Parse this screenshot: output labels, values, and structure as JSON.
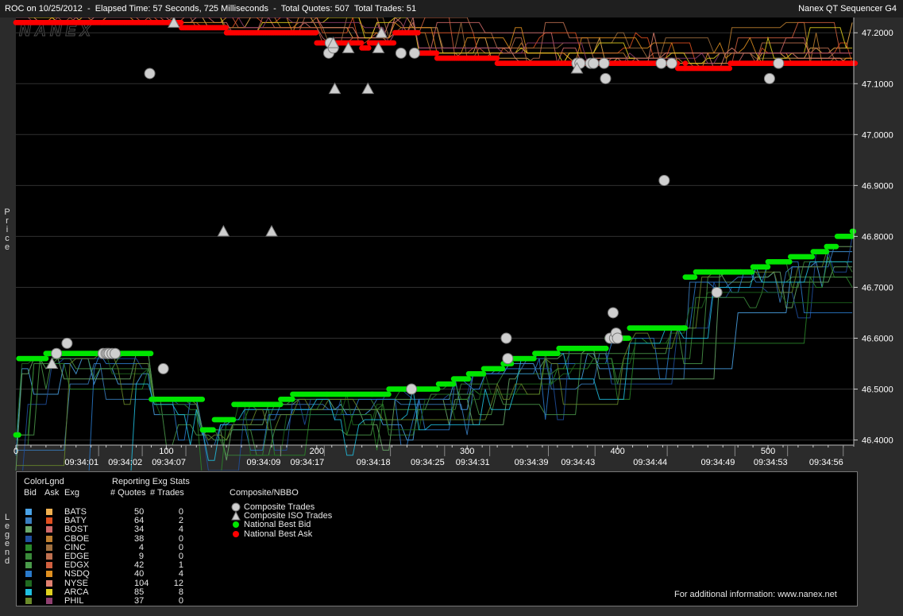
{
  "header": {
    "title_left": "ROC on 10/25/2012  -  Elapsed Time: 57 Seconds, 725 Milliseconds  -  Total Quotes: 507  Total Trades: 51",
    "title_right": "Nanex QT Sequencer G4"
  },
  "watermark": "NANEX",
  "side_labels": {
    "price": "Price",
    "legend": "Legend"
  },
  "colors": {
    "bid": "#00e600",
    "ask": "#ff0000",
    "trade": "#d0d0d0",
    "background": "#000000",
    "panel": "#2b2b2b"
  },
  "chart_data": {
    "type": "scatter",
    "ylabel": "Price",
    "ylim": [
      46.39,
      47.23
    ],
    "xlim": [
      0,
      557
    ],
    "y_ticks": [
      47.2,
      47.1,
      47.0,
      46.9,
      46.8,
      46.7,
      46.6,
      46.5,
      46.4
    ],
    "x_ticks": [
      0,
      100,
      200,
      300,
      400,
      500
    ],
    "time_labels": [
      {
        "seq": 55,
        "t": "09:34:01"
      },
      {
        "seq": 84,
        "t": "09:34:02"
      },
      {
        "seq": 113,
        "t": "09:34:07"
      },
      {
        "seq": 176,
        "t": "09:34:09"
      },
      {
        "seq": 205,
        "t": "09:34:17"
      },
      {
        "seq": 249,
        "t": "09:34:18"
      },
      {
        "seq": 285,
        "t": "09:34:25"
      },
      {
        "seq": 315,
        "t": "09:34:31"
      },
      {
        "seq": 354,
        "t": "09:34:39"
      },
      {
        "seq": 385,
        "t": "09:34:43"
      },
      {
        "seq": 433,
        "t": "09:34:44"
      },
      {
        "seq": 478,
        "t": "09:34:49"
      },
      {
        "seq": 513,
        "t": "09:34:53"
      },
      {
        "seq": 550,
        "t": "09:34:56"
      }
    ],
    "series": [
      {
        "name": "National Best Ask",
        "steps": [
          [
            0,
            47.22
          ],
          [
            110,
            47.21
          ],
          [
            140,
            47.2
          ],
          [
            200,
            47.18
          ],
          [
            230,
            47.17
          ],
          [
            235,
            47.18
          ],
          [
            252,
            47.2
          ],
          [
            268,
            47.16
          ],
          [
            280,
            47.15
          ],
          [
            300,
            47.15
          ],
          [
            320,
            47.14
          ],
          [
            380,
            47.14
          ],
          [
            420,
            47.14
          ],
          [
            440,
            47.13
          ],
          [
            445,
            47.14
          ],
          [
            445,
            47.13
          ],
          [
            470,
            47.13
          ],
          [
            475,
            47.14
          ],
          [
            500,
            47.14
          ],
          [
            557,
            47.14
          ]
        ]
      },
      {
        "name": "National Best Bid",
        "steps": [
          [
            0,
            46.41
          ],
          [
            2,
            46.56
          ],
          [
            20,
            46.57
          ],
          [
            50,
            46.57
          ],
          [
            65,
            46.57
          ],
          [
            78,
            46.57
          ],
          [
            90,
            46.48
          ],
          [
            123,
            46.48
          ],
          [
            124,
            46.42
          ],
          [
            132,
            46.44
          ],
          [
            145,
            46.47
          ],
          [
            175,
            46.47
          ],
          [
            176,
            46.48
          ],
          [
            183,
            46.48
          ],
          [
            184,
            46.49
          ],
          [
            207,
            46.49
          ],
          [
            216,
            46.49
          ],
          [
            237,
            46.49
          ],
          [
            248,
            46.5
          ],
          [
            281,
            46.51
          ],
          [
            291,
            46.52
          ],
          [
            301,
            46.53
          ],
          [
            311,
            46.54
          ],
          [
            324,
            46.55
          ],
          [
            330,
            46.56
          ],
          [
            345,
            46.57
          ],
          [
            361,
            46.58
          ],
          [
            378,
            46.58
          ],
          [
            393,
            46.6
          ],
          [
            408,
            46.62
          ],
          [
            444,
            46.62
          ],
          [
            445,
            46.72
          ],
          [
            452,
            46.73
          ],
          [
            482,
            46.73
          ],
          [
            490,
            46.74
          ],
          [
            500,
            46.75
          ],
          [
            515,
            46.76
          ],
          [
            530,
            46.77
          ],
          [
            539,
            46.78
          ],
          [
            546,
            46.8
          ],
          [
            556,
            46.81
          ]
        ]
      }
    ],
    "trades": [
      [
        27,
        46.57
      ],
      [
        34,
        46.59
      ],
      [
        58,
        46.57
      ],
      [
        60,
        46.57
      ],
      [
        61,
        46.57
      ],
      [
        62,
        46.57
      ],
      [
        64,
        46.57
      ],
      [
        66,
        46.57
      ],
      [
        89,
        47.12
      ],
      [
        98,
        46.54
      ],
      [
        208,
        47.16
      ],
      [
        209,
        47.18
      ],
      [
        211,
        47.17
      ],
      [
        256,
        47.16
      ],
      [
        265,
        47.16
      ],
      [
        263,
        46.5
      ],
      [
        326,
        46.6
      ],
      [
        327,
        46.56
      ],
      [
        373,
        47.14
      ],
      [
        375,
        47.14
      ],
      [
        382,
        47.14
      ],
      [
        384,
        47.14
      ],
      [
        391,
        47.14
      ],
      [
        392,
        47.11
      ],
      [
        395,
        46.6
      ],
      [
        397,
        46.65
      ],
      [
        398,
        46.6
      ],
      [
        399,
        46.61
      ],
      [
        400,
        46.6
      ],
      [
        429,
        47.14
      ],
      [
        431,
        46.91
      ],
      [
        436,
        47.14
      ],
      [
        466,
        46.69
      ],
      [
        501,
        47.11
      ],
      [
        507,
        47.14
      ]
    ],
    "iso_trades": [
      [
        24,
        46.55
      ],
      [
        105,
        47.22
      ],
      [
        138,
        46.81
      ],
      [
        170,
        46.81
      ],
      [
        211,
        47.18
      ],
      [
        212,
        47.09
      ],
      [
        221,
        47.17
      ],
      [
        234,
        47.09
      ],
      [
        241,
        47.17
      ],
      [
        243,
        47.2
      ],
      [
        373,
        47.13
      ]
    ]
  },
  "legend": {
    "header_colorlgnd": "ColorLgnd",
    "header_stats": "Reporting Exg Stats",
    "col_bid": "Bid",
    "col_ask": "Ask",
    "col_exg": "Exg",
    "col_quotes": "# Quotes",
    "col_trades": "# Trades",
    "exchanges": [
      {
        "exg": "BATS",
        "quotes": "50",
        "trades": "0",
        "bid": "#4aa3e8",
        "ask": "#f0b050"
      },
      {
        "exg": "BATY",
        "quotes": "64",
        "trades": "2",
        "bid": "#3a7ec0",
        "ask": "#e05020"
      },
      {
        "exg": "BOST",
        "quotes": "34",
        "trades": "4",
        "bid": "#6aaa6a",
        "ask": "#d06a6a"
      },
      {
        "exg": "CBOE",
        "quotes": "38",
        "trades": "0",
        "bid": "#2050a0",
        "ask": "#c08030"
      },
      {
        "exg": "CINC",
        "quotes": "4",
        "trades": "0",
        "bid": "#2a8a2a",
        "ask": "#a07040"
      },
      {
        "exg": "EDGE",
        "quotes": "9",
        "trades": "0",
        "bid": "#3a8a3a",
        "ask": "#c07050"
      },
      {
        "exg": "EDGX",
        "quotes": "42",
        "trades": "1",
        "bid": "#4a9a4a",
        "ask": "#d06040"
      },
      {
        "exg": "NSDQ",
        "quotes": "40",
        "trades": "4",
        "bid": "#2a7acc",
        "ask": "#e09020"
      },
      {
        "exg": "NYSE",
        "quotes": "104",
        "trades": "12",
        "bid": "#206a20",
        "ask": "#e08070"
      },
      {
        "exg": "ARCA",
        "quotes": "85",
        "trades": "8",
        "bid": "#20c0e0",
        "ask": "#e0d020"
      },
      {
        "exg": "PHIL",
        "quotes": "37",
        "trades": "0",
        "bid": "#6a8a2a",
        "ask": "#904070"
      }
    ],
    "composite_title": "Composite/NBBO",
    "composite_items": [
      "Composite Trades",
      "Composite ISO Trades",
      "National Best Bid",
      "National Best Ask"
    ],
    "info": "For additional information: www.nanex.net"
  }
}
